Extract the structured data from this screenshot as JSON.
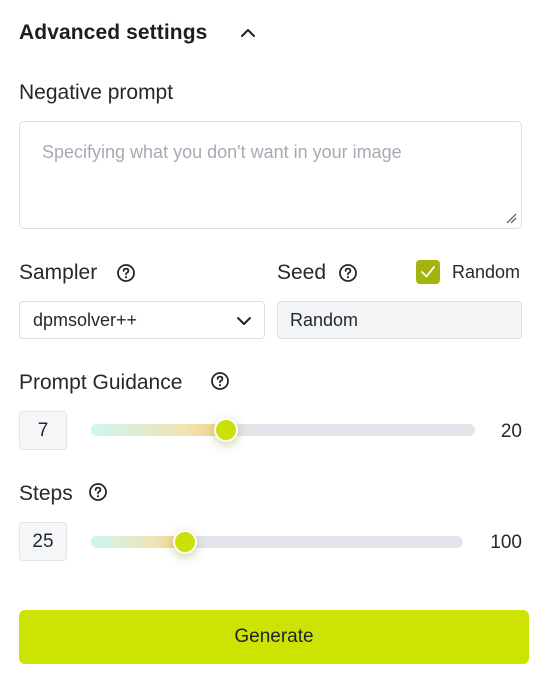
{
  "header": {
    "title": "Advanced settings",
    "toggle_icon": "chevron-up-icon"
  },
  "negative_prompt": {
    "label": "Negative prompt",
    "value": "",
    "placeholder": "Specifying what you don't want in your image"
  },
  "sampler": {
    "label": "Sampler",
    "help_icon": "help-circle-icon",
    "selected": "dpmsolver++",
    "dropdown_icon": "chevron-down-icon"
  },
  "seed": {
    "label": "Seed",
    "help_icon": "help-circle-icon",
    "value": "Random",
    "random_checkbox_label": "Random",
    "random_checked": true
  },
  "prompt_guidance": {
    "label": "Prompt Guidance",
    "help_icon": "help-circle-icon",
    "value": "7",
    "max_label": "20",
    "min": 0,
    "max": 20,
    "current": 7
  },
  "steps": {
    "label": "Steps",
    "help_icon": "help-circle-icon",
    "value": "25",
    "max_label": "100",
    "min": 0,
    "max": 100,
    "current": 25
  },
  "actions": {
    "generate_label": "Generate"
  },
  "colors": {
    "accent": "#cde303",
    "checkbox": "#a2b40d",
    "thumb": "#cbe00a",
    "track": "#e2e5e9"
  }
}
